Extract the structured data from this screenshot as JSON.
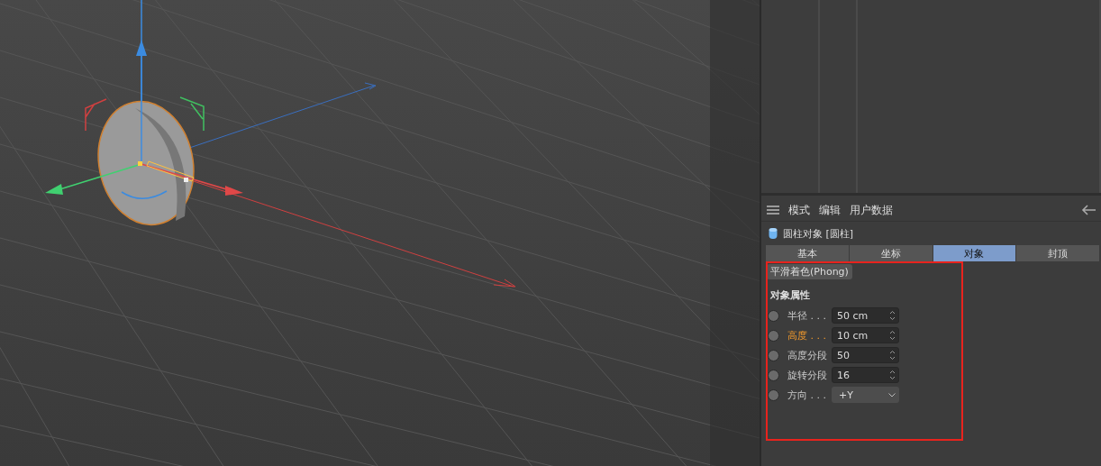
{
  "attributes_panel": {
    "menu": [
      "模式",
      "编辑",
      "用户数据"
    ],
    "object_title": "圆柱对象 [圆柱]",
    "tabs": [
      {
        "label": "基本",
        "selected": false
      },
      {
        "label": "坐标",
        "selected": false
      },
      {
        "label": "对象",
        "selected": true
      },
      {
        "label": "封顶",
        "selected": false
      }
    ],
    "phong_button": "平滑着色(Phong)",
    "section_title": "对象属性",
    "fields": [
      {
        "kind": "number",
        "label": "半径 . . .",
        "value": "50 cm",
        "highlighted": false
      },
      {
        "kind": "number",
        "label": "高度 . . .",
        "value": "10 cm",
        "highlighted": true
      },
      {
        "kind": "number",
        "label": "高度分段",
        "value": "50",
        "highlighted": false
      },
      {
        "kind": "number",
        "label": "旋转分段",
        "value": "16",
        "highlighted": false
      },
      {
        "kind": "dropdown",
        "label": "方向 . . .",
        "value": "+Y",
        "highlighted": false
      }
    ]
  }
}
